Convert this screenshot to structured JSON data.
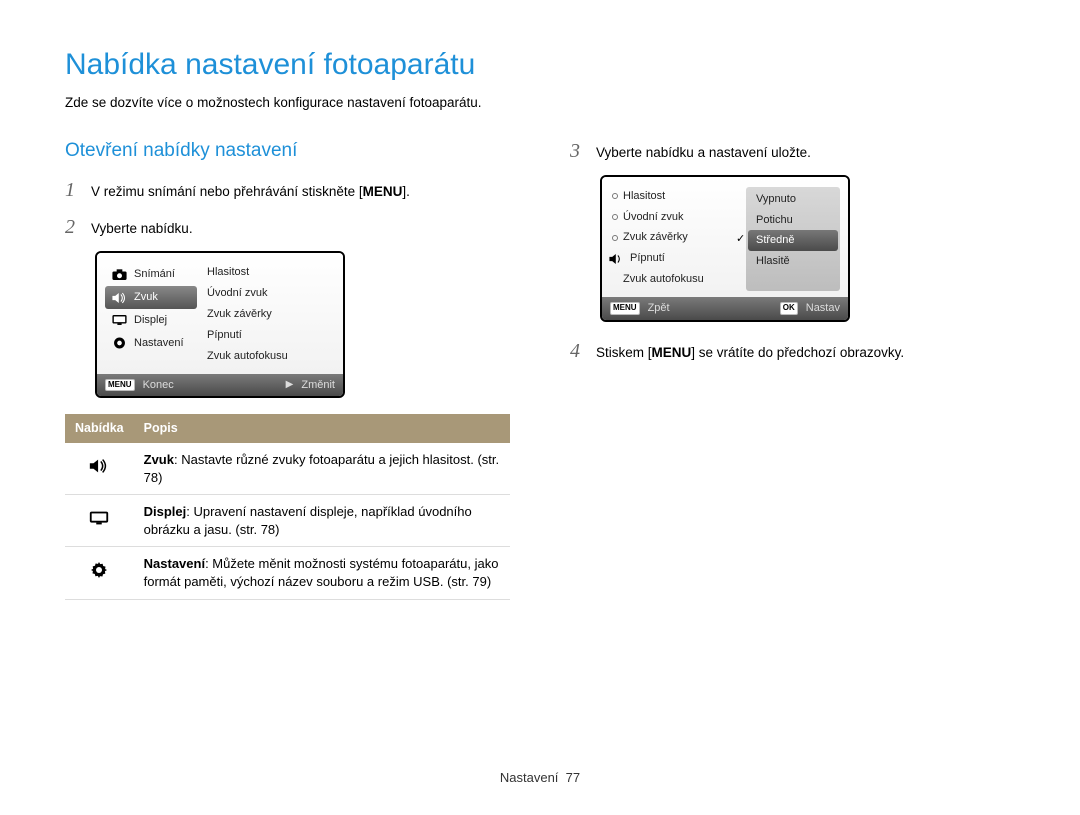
{
  "title": "Nabídka nastavení fotoaparátu",
  "subtitle": "Zde se dozvíte více o možnostech konfigurace nastavení fotoaparátu.",
  "section_heading": "Otevření nabídky nastavení",
  "keys": {
    "menu": "MENU",
    "ok": "OK"
  },
  "steps": {
    "1": {
      "pre": "V režimu snímání nebo přehrávání stiskněte [",
      "post": "]."
    },
    "2": "Vyberte nabídku.",
    "3": "Vyberte nabídku a nastavení uložte.",
    "4": {
      "pre": "Stiskem [",
      "post": "] se vrátíte do předchozí obrazovky."
    }
  },
  "screen1": {
    "leftItems": [
      {
        "label": "Snímání",
        "icon": "camera"
      },
      {
        "label": "Zvuk",
        "icon": "speaker",
        "selected": true
      },
      {
        "label": "Displej",
        "icon": "monitor"
      },
      {
        "label": "Nastavení",
        "icon": "gear"
      }
    ],
    "rightItems": [
      "Hlasitost",
      "Úvodní zvuk",
      "Zvuk závěrky",
      "Pípnutí",
      "Zvuk autofokusu"
    ],
    "footer": {
      "leftLabel": "Konec",
      "rightLabel": "Změnit"
    }
  },
  "screen2": {
    "leftIcon": "speaker",
    "leftItems": [
      "Hlasitost",
      "Úvodní zvuk",
      "Zvuk závěrky",
      "Pípnutí",
      "Zvuk autofokusu"
    ],
    "values": [
      {
        "label": "Vypnuto"
      },
      {
        "label": "Potichu"
      },
      {
        "label": "Středně",
        "selected": true
      },
      {
        "label": "Hlasitě"
      }
    ],
    "footer": {
      "leftLabel": "Zpět",
      "rightLabel": "Nastav"
    }
  },
  "table": {
    "headers": [
      "Nabídka",
      "Popis"
    ],
    "rows": [
      {
        "icon": "speaker",
        "bold": "Zvuk",
        "rest": ": Nastavte různé zvuky fotoaparátu a jejich hlasitost. (str. 78)"
      },
      {
        "icon": "monitor",
        "bold": "Displej",
        "rest": ": Upravení nastavení displeje, například úvodního obrázku a jasu. (str. 78)"
      },
      {
        "icon": "gear",
        "bold": "Nastavení",
        "rest": ": Můžete měnit možnosti systému fotoaparátu, jako formát paměti, výchozí název souboru a režim USB. (str. 79)"
      }
    ]
  },
  "footer": {
    "section": "Nastavení",
    "page": "77"
  }
}
